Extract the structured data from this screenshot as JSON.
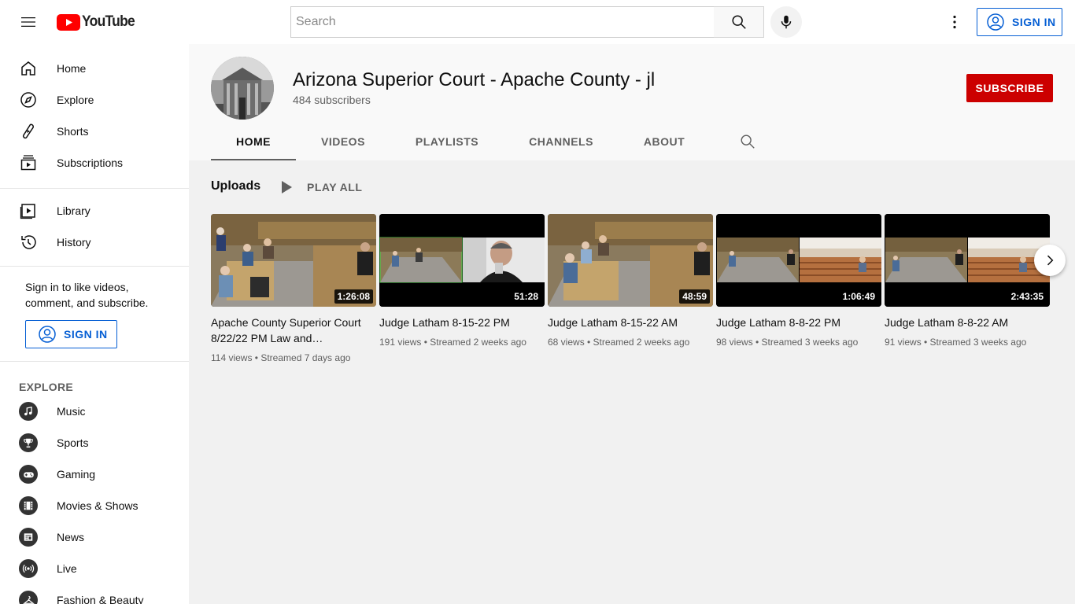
{
  "masthead": {
    "logo_text": "YouTube",
    "search_placeholder": "Search",
    "signin_label": "SIGN IN"
  },
  "sidebar": {
    "main_items": [
      {
        "label": "Home",
        "icon": "home-icon"
      },
      {
        "label": "Explore",
        "icon": "compass-icon"
      },
      {
        "label": "Shorts",
        "icon": "shorts-icon"
      },
      {
        "label": "Subscriptions",
        "icon": "subscriptions-icon"
      }
    ],
    "library_items": [
      {
        "label": "Library",
        "icon": "library-icon"
      },
      {
        "label": "History",
        "icon": "history-icon"
      }
    ],
    "signin_message": "Sign in to like videos, comment, and subscribe.",
    "signin_label": "SIGN IN",
    "explore_title": "EXPLORE",
    "explore_items": [
      {
        "label": "Music",
        "icon": "music-icon"
      },
      {
        "label": "Sports",
        "icon": "trophy-icon"
      },
      {
        "label": "Gaming",
        "icon": "gamepad-icon"
      },
      {
        "label": "Movies & Shows",
        "icon": "film-icon"
      },
      {
        "label": "News",
        "icon": "newspaper-icon"
      },
      {
        "label": "Live",
        "icon": "live-icon"
      },
      {
        "label": "Fashion & Beauty",
        "icon": "hanger-icon"
      }
    ]
  },
  "channel": {
    "title": "Arizona Superior Court - Apache County - jl",
    "subscribers": "484 subscribers",
    "subscribe_label": "SUBSCRIBE",
    "tabs": [
      "HOME",
      "VIDEOS",
      "PLAYLISTS",
      "CHANNELS",
      "ABOUT"
    ],
    "active_tab": "HOME"
  },
  "shelf": {
    "title": "Uploads",
    "play_all_label": "PLAY ALL",
    "videos": [
      {
        "title": "Apache County Superior Court 8/22/22 PM Law and…",
        "meta": "114 views • Streamed 7 days ago",
        "duration": "1:26:08",
        "thumb_style": "courtroom"
      },
      {
        "title": "Judge Latham 8-15-22 PM",
        "meta": "191 views • Streamed 2 weeks ago",
        "duration": "51:28",
        "thumb_style": "split-person"
      },
      {
        "title": "Judge Latham 8-15-22 AM",
        "meta": "68 views • Streamed 2 weeks ago",
        "duration": "48:59",
        "thumb_style": "courtroom"
      },
      {
        "title": "Judge Latham 8-8-22 PM",
        "meta": "98 views • Streamed 3 weeks ago",
        "duration": "1:06:49",
        "thumb_style": "split-gallery"
      },
      {
        "title": "Judge Latham 8-8-22 AM",
        "meta": "91 views • Streamed 3 weeks ago",
        "duration": "2:43:35",
        "thumb_style": "split-gallery"
      }
    ]
  },
  "colors": {
    "brand_red": "#ff0000",
    "subscribe_red": "#cc0000",
    "link_blue": "#065fd4"
  }
}
